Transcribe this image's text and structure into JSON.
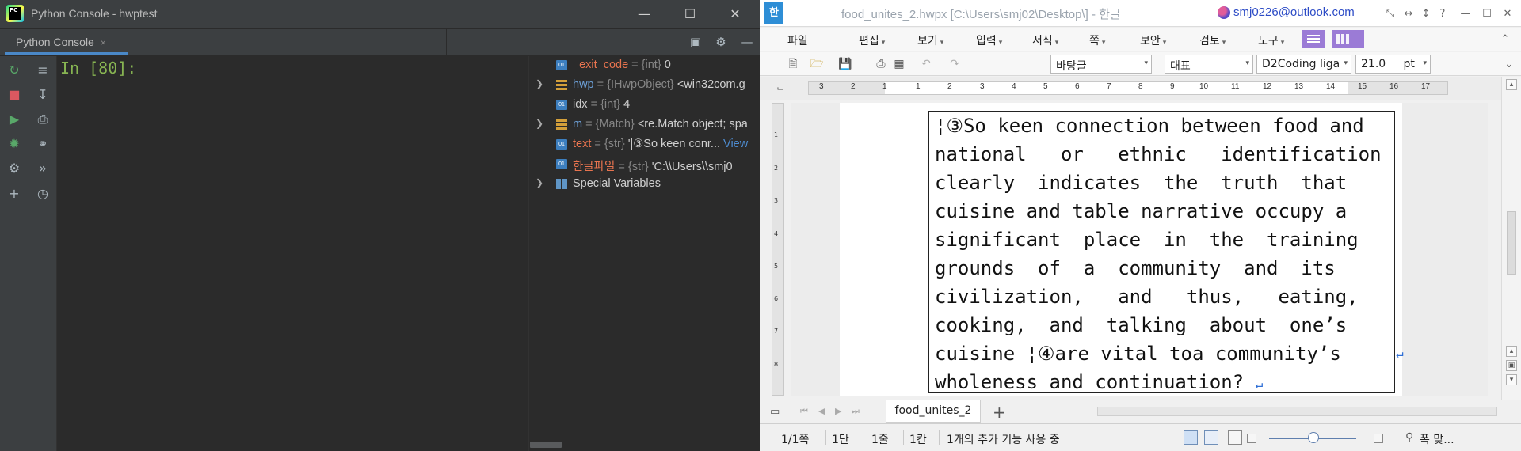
{
  "pycharm": {
    "window_title": "Python Console - hwptest",
    "logo_text": "PC",
    "tab_label": "Python Console",
    "tab_close": "×",
    "prompt": "In [80]:",
    "variables": [
      {
        "name": "_exit_code",
        "type": "{int}",
        "value": "0",
        "kind": "int",
        "expandable": false
      },
      {
        "name": "hwp",
        "type": "{IHwpObject}",
        "value": "<win32com.g",
        "kind": "object",
        "expandable": true
      },
      {
        "name": "idx",
        "type": "{int}",
        "value": "4",
        "kind": "int",
        "expandable": false
      },
      {
        "name": "m",
        "type": "{Match}",
        "value": "<re.Match object; spa",
        "kind": "object",
        "expandable": true
      },
      {
        "name": "text",
        "type": "{str}",
        "value": "'|③So keen conr...",
        "link": "View",
        "kind": "str",
        "expandable": false
      },
      {
        "name": "한글파일",
        "type": "{str}",
        "value": "'C:\\\\Users\\\\smj0",
        "kind": "str",
        "expandable": false
      },
      {
        "name": "Special Variables",
        "type": "",
        "value": "",
        "kind": "special",
        "expandable": true
      }
    ]
  },
  "hwp": {
    "logo_text": "한",
    "window_title": "food_unites_2.hwpx [C:\\Users\\smj02\\Desktop\\] - 한글",
    "account_email": "smj0226@outlook.com",
    "menu": [
      "파일",
      "편집",
      "보기",
      "입력",
      "서식",
      "쪽",
      "보안",
      "검토",
      "도구"
    ],
    "toolbar": {
      "style": "바탕글",
      "font_group": "대표",
      "font": "D2Coding liga",
      "size": "21.0",
      "unit": "pt"
    },
    "ruler_numbers": [
      "3",
      "2",
      "1",
      "1",
      "2",
      "3",
      "4",
      "5",
      "6",
      "7",
      "8",
      "9",
      "10",
      "11",
      "12",
      "13",
      "14",
      "15",
      "16",
      "17"
    ],
    "vruler_numbers": [
      "1",
      "2",
      "3",
      "4",
      "5",
      "6",
      "7",
      "8"
    ],
    "doc_lines": [
      "¦③So keen connection between food and",
      "national   or   ethnic   identification",
      "clearly  indicates  the  truth  that",
      "cuisine and table narrative occupy a",
      "significant  place  in  the  training",
      "grounds  of  a  community  and  its",
      "civilization,   and   thus,   eating,",
      "cooking,  and  talking  about  one’s",
      "cuisine ¦④are vital toa community’s",
      "wholeness and continuation? "
    ],
    "para_mark": "↵",
    "doc_tab": "food_unites_2",
    "status": {
      "page": "1/1쪽",
      "column": "1단",
      "line": "1줄",
      "cell": "1칸",
      "message": "1개의 추가 기능 사용 중",
      "zoom_label": "폭 맞..."
    }
  }
}
